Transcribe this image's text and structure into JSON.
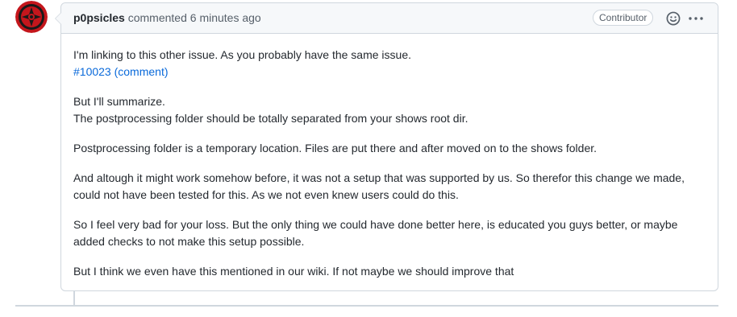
{
  "comment": {
    "author": "p0psicles",
    "action": "commented",
    "time": "6 minutes ago",
    "role_badge": "Contributor",
    "icons": {
      "avatar": "avatar",
      "reaction": "smiley-icon",
      "more": "kebab-horizontal-icon"
    },
    "body": {
      "p1_line1": "I'm linking to this other issue. As you probably have the same issue.",
      "p1_link": "#10023 (comment)",
      "p2_line1": "But I'll summarize.",
      "p2_line2": "The postprocessing folder should be totally separated from your shows root dir.",
      "p3": "Postprocessing folder is a temporary location. Files are put there and after moved on to the shows folder.",
      "p4": "And altough it might work somehow before, it was not a setup that was supported by us. So therefor this change we made, could not have been tested for this. As we not even knew users could do this.",
      "p5": "So I feel very bad for your loss. But the only thing we could have done better here, is educated you guys better, or maybe added checks to not make this setup possible.",
      "p6": "But I think we even have this mentioned in our wiki. If not maybe we should improve that"
    }
  },
  "colors": {
    "border": "#d0d7de",
    "header_bg": "#f6f8fa",
    "link": "#0969da",
    "text": "#24292f",
    "muted": "#57606a",
    "avatar_red": "#c4161c"
  }
}
